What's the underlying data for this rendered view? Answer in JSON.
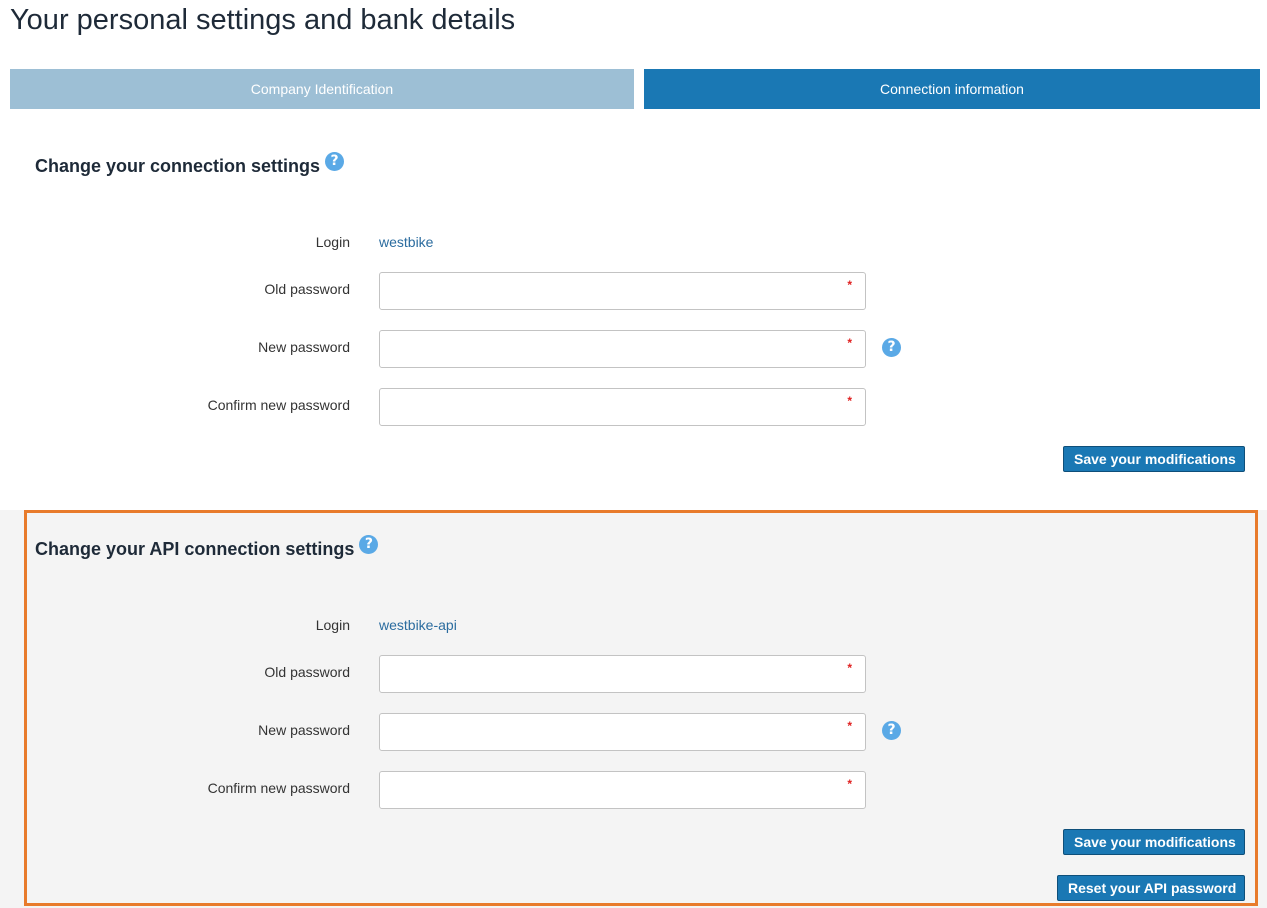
{
  "page": {
    "title": "Your personal settings and bank details"
  },
  "tabs": [
    {
      "label": "Company Identification",
      "active": false
    },
    {
      "label": "Connection information",
      "active": true
    }
  ],
  "colors": {
    "tab_inactive": "#9dbfd5",
    "tab_active": "#1a78b4",
    "button": "#1a78b4",
    "highlight_outline": "#e87b2b",
    "help_icon": "#5aa9e6",
    "required_marker": "#e02020"
  },
  "connection": {
    "title": "Change your connection settings",
    "help_icon": "question-circle-icon",
    "login_label": "Login",
    "login_value": "westbike",
    "old_password_label": "Old password",
    "new_password_label": "New password",
    "confirm_password_label": "Confirm new password",
    "old_password_value": "",
    "new_password_value": "",
    "confirm_password_value": "",
    "required_marker": "*",
    "save_label": "Save your modifications"
  },
  "api": {
    "title": "Change your API connection settings",
    "help_icon": "question-circle-icon",
    "login_label": "Login",
    "login_value": "westbike-api",
    "old_password_label": "Old password",
    "new_password_label": "New password",
    "confirm_password_label": "Confirm new password",
    "old_password_value": "",
    "new_password_value": "",
    "confirm_password_value": "",
    "required_marker": "*",
    "save_label": "Save your modifications",
    "reset_label": "Reset your API password"
  }
}
